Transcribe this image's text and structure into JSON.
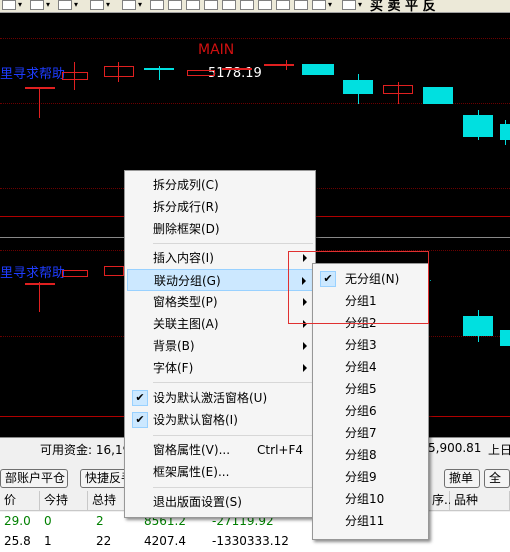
{
  "toolbar": {
    "trailing_text": "买 卖 平 反"
  },
  "chart": {
    "title": "MAIN",
    "price_label": "5178.19",
    "help_text_top": "里寻求帮助",
    "help_text_bottom": "里寻求帮助",
    "colors": {
      "background": "#000000",
      "up": "#e02020",
      "down": "#00e0e0",
      "title": "#d01010",
      "help": "#1e3cff"
    }
  },
  "funds": {
    "available": "可用资金:  16,195,1",
    "right_value": "5,900.81",
    "right_edge": "上日"
  },
  "buttons": {
    "close_account": "部账户平仓",
    "quick_reverse": "快捷反手",
    "withdraw": "撤单",
    "all": "全"
  },
  "positions": {
    "headers": [
      "价",
      "今持",
      "总持"
    ],
    "right_headers": [
      "序..",
      "品种"
    ],
    "rows": [
      [
        "29.0",
        "0",
        "2",
        "8561.2",
        "-27119.92"
      ],
      [
        "25.8",
        "1",
        "22",
        "4207.4",
        "-1330333.12"
      ]
    ]
  },
  "context_menu": {
    "items": [
      {
        "label": "拆分成列(C)",
        "type": "item"
      },
      {
        "label": "拆分成行(R)",
        "type": "item"
      },
      {
        "label": "删除框架(D)",
        "type": "item"
      },
      {
        "type": "separator"
      },
      {
        "label": "插入内容(I)",
        "type": "submenu"
      },
      {
        "label": "联动分组(G)",
        "type": "submenu",
        "highlighted": true
      },
      {
        "label": "窗格类型(P)",
        "type": "submenu"
      },
      {
        "label": "关联主图(A)",
        "type": "submenu"
      },
      {
        "label": "背景(B)",
        "type": "submenu"
      },
      {
        "label": "字体(F)",
        "type": "submenu"
      },
      {
        "type": "separator"
      },
      {
        "label": "设为默认激活窗格(U)",
        "type": "check",
        "checked": true
      },
      {
        "label": "设为默认窗格(I)",
        "type": "check",
        "checked": true
      },
      {
        "type": "separator"
      },
      {
        "label": "窗格属性(V)...",
        "shortcut": "Ctrl+F4",
        "type": "item"
      },
      {
        "label": "框架属性(E)...",
        "type": "item"
      },
      {
        "type": "separator"
      },
      {
        "label": "退出版面设置(S)",
        "type": "item"
      }
    ]
  },
  "submenu": {
    "items": [
      {
        "label": "无分组(N)",
        "checked": true
      },
      {
        "label": "分组1"
      },
      {
        "label": "分组2"
      },
      {
        "label": "分组3"
      },
      {
        "label": "分组4"
      },
      {
        "label": "分组5"
      },
      {
        "label": "分组6"
      },
      {
        "label": "分组7"
      },
      {
        "label": "分组8"
      },
      {
        "label": "分组9"
      },
      {
        "label": "分组10"
      },
      {
        "label": "分组11"
      }
    ]
  }
}
